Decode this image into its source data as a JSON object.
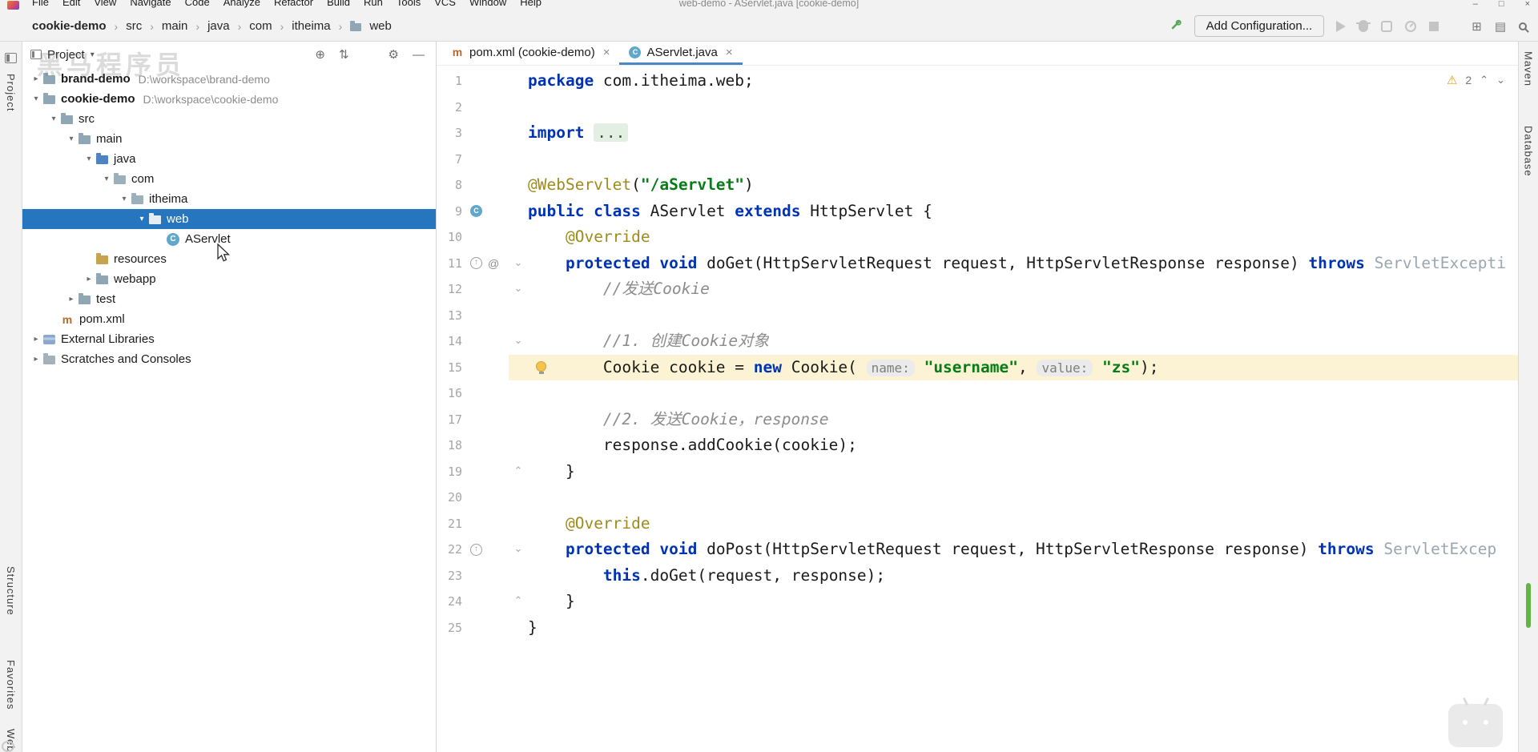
{
  "window": {
    "menu_items": [
      "File",
      "Edit",
      "View",
      "Navigate",
      "Code",
      "Analyze",
      "Refactor",
      "Build",
      "Run",
      "Tools",
      "VCS",
      "Window",
      "Help"
    ],
    "title": "web-demo - AServlet.java [cookie-demo]",
    "controls": [
      "minimize",
      "maximize",
      "close"
    ]
  },
  "toolbar": {
    "breadcrumbs": [
      {
        "label": "cookie-demo",
        "bold": true
      },
      {
        "label": "src"
      },
      {
        "label": "main"
      },
      {
        "label": "java"
      },
      {
        "label": "com"
      },
      {
        "label": "itheima"
      },
      {
        "label": "web",
        "icon": "folder"
      }
    ],
    "add_configuration_label": "Add Configuration...",
    "run_controls": [
      "run",
      "debug",
      "coverage",
      "profiler",
      "stop"
    ],
    "far_icons": [
      "services",
      "layout",
      "search"
    ]
  },
  "project_panel": {
    "title": "Project",
    "header_icons": [
      "locate",
      "collapse-all",
      "settings",
      "hide"
    ],
    "tree": [
      {
        "label": "brand-demo",
        "detail": "D:\\workspace\\brand-demo",
        "level": 0,
        "icon": "folder",
        "chevron": "right",
        "bold": true
      },
      {
        "label": "cookie-demo",
        "detail": "D:\\workspace\\cookie-demo",
        "level": 0,
        "icon": "folder",
        "chevron": "down",
        "bold": true
      },
      {
        "label": "src",
        "level": 1,
        "icon": "folder",
        "chevron": "down"
      },
      {
        "label": "main",
        "level": 2,
        "icon": "folder",
        "chevron": "down"
      },
      {
        "label": "java",
        "level": 3,
        "icon": "folder-src",
        "chevron": "down"
      },
      {
        "label": "com",
        "level": 4,
        "icon": "package",
        "chevron": "down"
      },
      {
        "label": "itheima",
        "level": 5,
        "icon": "package",
        "chevron": "down"
      },
      {
        "label": "web",
        "level": 6,
        "icon": "package",
        "chevron": "down",
        "selected": true
      },
      {
        "label": "AServlet",
        "level": 7,
        "icon": "class"
      },
      {
        "label": "resources",
        "level": 3,
        "icon": "folder-res"
      },
      {
        "label": "webapp",
        "level": 3,
        "icon": "folder",
        "chevron": "right"
      },
      {
        "label": "test",
        "level": 2,
        "icon": "folder",
        "chevron": "right"
      },
      {
        "label": "pom.xml",
        "level": 1,
        "icon": "maven"
      },
      {
        "label": "External Libraries",
        "level": 0,
        "icon": "lib",
        "chevron": "right"
      },
      {
        "label": "Scratches and Consoles",
        "level": 0,
        "icon": "scratch",
        "chevron": "right"
      }
    ]
  },
  "editor": {
    "tabs": [
      {
        "label": "pom.xml (cookie-demo)",
        "icon": "maven"
      },
      {
        "label": "AServlet.java",
        "icon": "class",
        "active": true
      }
    ],
    "warning_count": "2",
    "lines": [
      {
        "num": "1",
        "segments": [
          {
            "c": "kw",
            "t": "package "
          },
          {
            "c": "plain",
            "t": "com.itheima.web;"
          }
        ]
      },
      {
        "num": "2",
        "segments": []
      },
      {
        "num": "3",
        "segments": [
          {
            "c": "kw",
            "t": "import "
          },
          {
            "c": "fold",
            "t": "..."
          }
        ]
      },
      {
        "num": "7",
        "segments": []
      },
      {
        "num": "8",
        "segments": [
          {
            "c": "ann",
            "t": "@WebServlet"
          },
          {
            "c": "plain",
            "t": "("
          },
          {
            "c": "str",
            "t": "\"/aServlet\""
          },
          {
            "c": "plain",
            "t": ")"
          }
        ]
      },
      {
        "num": "9",
        "gutter": "class",
        "segments": [
          {
            "c": "kw",
            "t": "public class "
          },
          {
            "c": "plain",
            "t": "AServlet "
          },
          {
            "c": "kw",
            "t": "extends "
          },
          {
            "c": "plain",
            "t": "HttpServlet {"
          }
        ]
      },
      {
        "num": "10",
        "segments": [
          {
            "c": "plain",
            "t": "    "
          },
          {
            "c": "ann",
            "t": "@Override"
          }
        ]
      },
      {
        "num": "11",
        "gutter": "override-at",
        "fold": "down",
        "segments": [
          {
            "c": "plain",
            "t": "    "
          },
          {
            "c": "kw",
            "t": "protected void "
          },
          {
            "c": "plain",
            "t": "doGet(HttpServletRequest request, HttpServletResponse response) "
          },
          {
            "c": "kw",
            "t": "throws "
          },
          {
            "c": "gray",
            "t": "ServletExcepti"
          }
        ]
      },
      {
        "num": "12",
        "fold": "down",
        "segments": [
          {
            "c": "plain",
            "t": "        "
          },
          {
            "c": "cmt",
            "t": "//发送Cookie"
          }
        ]
      },
      {
        "num": "13",
        "segments": []
      },
      {
        "num": "14",
        "fold": "down",
        "segments": [
          {
            "c": "plain",
            "t": "        "
          },
          {
            "c": "cmt",
            "t": "//1. 创建Cookie对象"
          }
        ]
      },
      {
        "num": "15",
        "bulb": true,
        "highlight": true,
        "segments": [
          {
            "c": "plain",
            "t": "        "
          },
          {
            "c": "plain",
            "t": "Cookie cookie = "
          },
          {
            "c": "kw",
            "t": "new "
          },
          {
            "c": "plain",
            "t": "Cookie( "
          },
          {
            "c": "inlay",
            "t": "name:"
          },
          {
            "c": "plain",
            "t": " "
          },
          {
            "c": "str",
            "t": "\"username\""
          },
          {
            "c": "plain",
            "t": ", "
          },
          {
            "c": "inlay",
            "t": "value:"
          },
          {
            "c": "plain",
            "t": " "
          },
          {
            "c": "str",
            "t": "\"zs\""
          },
          {
            "c": "plain",
            "t": ");"
          }
        ]
      },
      {
        "num": "16",
        "segments": []
      },
      {
        "num": "17",
        "segments": [
          {
            "c": "plain",
            "t": "        "
          },
          {
            "c": "cmt",
            "t": "//2. 发送Cookie，response"
          }
        ]
      },
      {
        "num": "18",
        "segments": [
          {
            "c": "plain",
            "t": "        "
          },
          {
            "c": "plain",
            "t": "response.addCookie(cookie);"
          }
        ]
      },
      {
        "num": "19",
        "fold": "up",
        "segments": [
          {
            "c": "plain",
            "t": "    }"
          }
        ]
      },
      {
        "num": "20",
        "segments": []
      },
      {
        "num": "21",
        "segments": [
          {
            "c": "plain",
            "t": "    "
          },
          {
            "c": "ann",
            "t": "@Override"
          }
        ]
      },
      {
        "num": "22",
        "gutter": "override",
        "fold": "down",
        "segments": [
          {
            "c": "plain",
            "t": "    "
          },
          {
            "c": "kw",
            "t": "protected void "
          },
          {
            "c": "plain",
            "t": "doPost(HttpServletRequest request, HttpServletResponse response) "
          },
          {
            "c": "kw",
            "t": "throws "
          },
          {
            "c": "gray",
            "t": "ServletExcep"
          }
        ]
      },
      {
        "num": "23",
        "segments": [
          {
            "c": "plain",
            "t": "        "
          },
          {
            "c": "kw",
            "t": "this"
          },
          {
            "c": "plain",
            "t": ".doGet(request, response);"
          }
        ]
      },
      {
        "num": "24",
        "fold": "up",
        "segments": [
          {
            "c": "plain",
            "t": "    }"
          }
        ]
      },
      {
        "num": "25",
        "segments": [
          {
            "c": "plain",
            "t": "}"
          }
        ]
      }
    ]
  },
  "left_stripe": {
    "top_label": "Project",
    "bottom_labels": [
      "Structure",
      "Favorites",
      "Web"
    ]
  },
  "right_stripe": {
    "labels": [
      "Maven",
      "Database"
    ],
    "scroll_marker_color": "#62b543"
  },
  "watermark": {
    "text": "黑马程序员"
  },
  "colors": {
    "selection": "#2675bf",
    "keyword": "#0033b3",
    "string": "#067d17",
    "comment": "#8c8c8c",
    "annotation": "#9f8b1d",
    "line_highlight": "#fbf3d3",
    "active_tab_underline": "#4a88c5"
  }
}
